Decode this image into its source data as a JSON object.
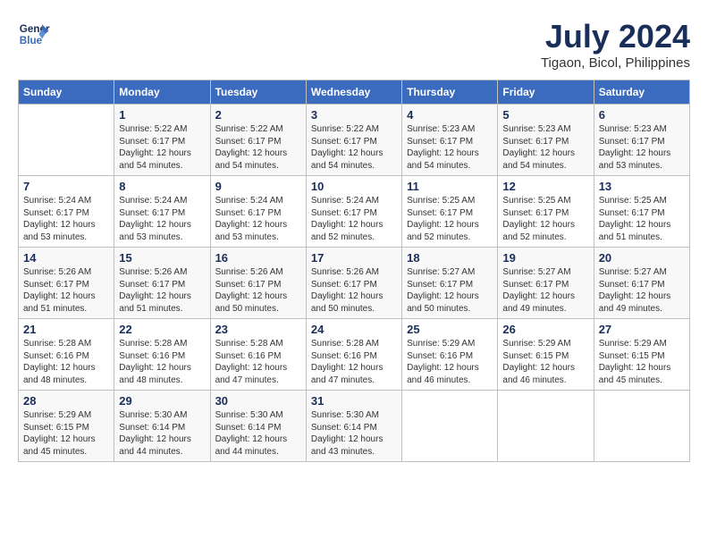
{
  "header": {
    "logo_line1": "General",
    "logo_line2": "Blue",
    "month": "July 2024",
    "location": "Tigaon, Bicol, Philippines"
  },
  "columns": [
    "Sunday",
    "Monday",
    "Tuesday",
    "Wednesday",
    "Thursday",
    "Friday",
    "Saturday"
  ],
  "weeks": [
    [
      {
        "day": "",
        "sunrise": "",
        "sunset": "",
        "daylight": ""
      },
      {
        "day": "1",
        "sunrise": "Sunrise: 5:22 AM",
        "sunset": "Sunset: 6:17 PM",
        "daylight": "Daylight: 12 hours and 54 minutes."
      },
      {
        "day": "2",
        "sunrise": "Sunrise: 5:22 AM",
        "sunset": "Sunset: 6:17 PM",
        "daylight": "Daylight: 12 hours and 54 minutes."
      },
      {
        "day": "3",
        "sunrise": "Sunrise: 5:22 AM",
        "sunset": "Sunset: 6:17 PM",
        "daylight": "Daylight: 12 hours and 54 minutes."
      },
      {
        "day": "4",
        "sunrise": "Sunrise: 5:23 AM",
        "sunset": "Sunset: 6:17 PM",
        "daylight": "Daylight: 12 hours and 54 minutes."
      },
      {
        "day": "5",
        "sunrise": "Sunrise: 5:23 AM",
        "sunset": "Sunset: 6:17 PM",
        "daylight": "Daylight: 12 hours and 54 minutes."
      },
      {
        "day": "6",
        "sunrise": "Sunrise: 5:23 AM",
        "sunset": "Sunset: 6:17 PM",
        "daylight": "Daylight: 12 hours and 53 minutes."
      }
    ],
    [
      {
        "day": "7",
        "sunrise": "Sunrise: 5:24 AM",
        "sunset": "Sunset: 6:17 PM",
        "daylight": "Daylight: 12 hours and 53 minutes."
      },
      {
        "day": "8",
        "sunrise": "Sunrise: 5:24 AM",
        "sunset": "Sunset: 6:17 PM",
        "daylight": "Daylight: 12 hours and 53 minutes."
      },
      {
        "day": "9",
        "sunrise": "Sunrise: 5:24 AM",
        "sunset": "Sunset: 6:17 PM",
        "daylight": "Daylight: 12 hours and 53 minutes."
      },
      {
        "day": "10",
        "sunrise": "Sunrise: 5:24 AM",
        "sunset": "Sunset: 6:17 PM",
        "daylight": "Daylight: 12 hours and 52 minutes."
      },
      {
        "day": "11",
        "sunrise": "Sunrise: 5:25 AM",
        "sunset": "Sunset: 6:17 PM",
        "daylight": "Daylight: 12 hours and 52 minutes."
      },
      {
        "day": "12",
        "sunrise": "Sunrise: 5:25 AM",
        "sunset": "Sunset: 6:17 PM",
        "daylight": "Daylight: 12 hours and 52 minutes."
      },
      {
        "day": "13",
        "sunrise": "Sunrise: 5:25 AM",
        "sunset": "Sunset: 6:17 PM",
        "daylight": "Daylight: 12 hours and 51 minutes."
      }
    ],
    [
      {
        "day": "14",
        "sunrise": "Sunrise: 5:26 AM",
        "sunset": "Sunset: 6:17 PM",
        "daylight": "Daylight: 12 hours and 51 minutes."
      },
      {
        "day": "15",
        "sunrise": "Sunrise: 5:26 AM",
        "sunset": "Sunset: 6:17 PM",
        "daylight": "Daylight: 12 hours and 51 minutes."
      },
      {
        "day": "16",
        "sunrise": "Sunrise: 5:26 AM",
        "sunset": "Sunset: 6:17 PM",
        "daylight": "Daylight: 12 hours and 50 minutes."
      },
      {
        "day": "17",
        "sunrise": "Sunrise: 5:26 AM",
        "sunset": "Sunset: 6:17 PM",
        "daylight": "Daylight: 12 hours and 50 minutes."
      },
      {
        "day": "18",
        "sunrise": "Sunrise: 5:27 AM",
        "sunset": "Sunset: 6:17 PM",
        "daylight": "Daylight: 12 hours and 50 minutes."
      },
      {
        "day": "19",
        "sunrise": "Sunrise: 5:27 AM",
        "sunset": "Sunset: 6:17 PM",
        "daylight": "Daylight: 12 hours and 49 minutes."
      },
      {
        "day": "20",
        "sunrise": "Sunrise: 5:27 AM",
        "sunset": "Sunset: 6:17 PM",
        "daylight": "Daylight: 12 hours and 49 minutes."
      }
    ],
    [
      {
        "day": "21",
        "sunrise": "Sunrise: 5:28 AM",
        "sunset": "Sunset: 6:16 PM",
        "daylight": "Daylight: 12 hours and 48 minutes."
      },
      {
        "day": "22",
        "sunrise": "Sunrise: 5:28 AM",
        "sunset": "Sunset: 6:16 PM",
        "daylight": "Daylight: 12 hours and 48 minutes."
      },
      {
        "day": "23",
        "sunrise": "Sunrise: 5:28 AM",
        "sunset": "Sunset: 6:16 PM",
        "daylight": "Daylight: 12 hours and 47 minutes."
      },
      {
        "day": "24",
        "sunrise": "Sunrise: 5:28 AM",
        "sunset": "Sunset: 6:16 PM",
        "daylight": "Daylight: 12 hours and 47 minutes."
      },
      {
        "day": "25",
        "sunrise": "Sunrise: 5:29 AM",
        "sunset": "Sunset: 6:16 PM",
        "daylight": "Daylight: 12 hours and 46 minutes."
      },
      {
        "day": "26",
        "sunrise": "Sunrise: 5:29 AM",
        "sunset": "Sunset: 6:15 PM",
        "daylight": "Daylight: 12 hours and 46 minutes."
      },
      {
        "day": "27",
        "sunrise": "Sunrise: 5:29 AM",
        "sunset": "Sunset: 6:15 PM",
        "daylight": "Daylight: 12 hours and 45 minutes."
      }
    ],
    [
      {
        "day": "28",
        "sunrise": "Sunrise: 5:29 AM",
        "sunset": "Sunset: 6:15 PM",
        "daylight": "Daylight: 12 hours and 45 minutes."
      },
      {
        "day": "29",
        "sunrise": "Sunrise: 5:30 AM",
        "sunset": "Sunset: 6:14 PM",
        "daylight": "Daylight: 12 hours and 44 minutes."
      },
      {
        "day": "30",
        "sunrise": "Sunrise: 5:30 AM",
        "sunset": "Sunset: 6:14 PM",
        "daylight": "Daylight: 12 hours and 44 minutes."
      },
      {
        "day": "31",
        "sunrise": "Sunrise: 5:30 AM",
        "sunset": "Sunset: 6:14 PM",
        "daylight": "Daylight: 12 hours and 43 minutes."
      },
      {
        "day": "",
        "sunrise": "",
        "sunset": "",
        "daylight": ""
      },
      {
        "day": "",
        "sunrise": "",
        "sunset": "",
        "daylight": ""
      },
      {
        "day": "",
        "sunrise": "",
        "sunset": "",
        "daylight": ""
      }
    ]
  ]
}
